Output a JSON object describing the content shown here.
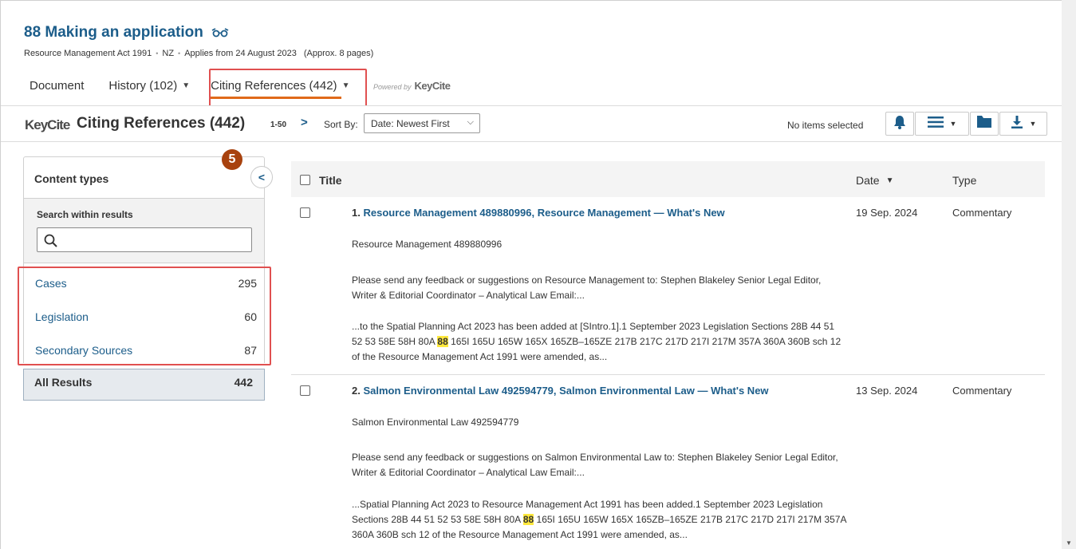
{
  "document": {
    "title": "88 Making an application",
    "meta": [
      "Resource Management Act 1991",
      "NZ",
      "Applies from 24 August 2023"
    ],
    "pages": "(Approx. 8 pages)"
  },
  "tabs": [
    {
      "label": "Document"
    },
    {
      "label": "History (102)"
    },
    {
      "label": "Citing References (442)"
    }
  ],
  "powered_by": {
    "text": "Powered by",
    "brand": "KeyCite"
  },
  "toolbar": {
    "logo": "KeyCite",
    "title": "Citing References (442)",
    "range": "1-50",
    "sort_label": "Sort By:",
    "sort_value": "Date: Newest First",
    "selection_status": "No items selected"
  },
  "sidebar": {
    "badge": "5",
    "heading": "Content types",
    "search_label": "Search within results",
    "search_placeholder": "",
    "facets": [
      {
        "name": "Cases",
        "count": "295"
      },
      {
        "name": "Legislation",
        "count": "60"
      },
      {
        "name": "Secondary Sources",
        "count": "87"
      }
    ],
    "all": {
      "name": "All Results",
      "count": "442"
    }
  },
  "table": {
    "columns": {
      "title": "Title",
      "date": "Date",
      "type": "Type"
    },
    "rows": [
      {
        "num": "1.",
        "title": "Resource Management 489880996, Resource Management — What's New",
        "date": "19 Sep. 2024",
        "type": "Commentary",
        "source": "Resource Management 489880996",
        "summary": "Please send any feedback or suggestions on Resource Management to: Stephen Blakeley Senior Legal Editor, Writer & Editorial Coordinator – Analytical Law Email:...",
        "snippet_before": "...to the Spatial Planning Act 2023 has been added at [SIntro.1].1 September 2023 Legislation Sections 28B 44 51 52 53 58E 58H 80A ",
        "snippet_hit": "88",
        "snippet_after": " 165I 165U 165W 165X 165ZB–165ZE 217B 217C 217D 217I 217M 357A 360A 360B sch 12 of the Resource Management Act 1991 were amended, as..."
      },
      {
        "num": "2.",
        "title": "Salmon Environmental Law 492594779, Salmon Environmental Law — What's New",
        "date": "13 Sep. 2024",
        "type": "Commentary",
        "source": "Salmon Environmental Law 492594779",
        "summary": "Please send any feedback or suggestions on Salmon Environmental Law to: Stephen Blakeley Senior Legal Editor, Writer & Editorial Coordinator – Analytical Law Email:...",
        "snippet_before": "...Spatial Planning Act 2023 to Resource Management Act 1991 has been added.1 September 2023 Legislation Sections 28B 44 51 52 53 58E 58H 80A ",
        "snippet_hit": "88",
        "snippet_after": " 165I 165U 165W 165X 165ZB–165ZE 217B 217C 217D 217I 217M 357A 360A 360B sch 12 of the Resource Management Act 1991 were amended, as..."
      }
    ]
  },
  "colors": {
    "link": "#1c5d8a",
    "accent": "#e06a1a",
    "callout": "#e05050",
    "badge": "#a8420e",
    "highlight": "#ffe83d"
  }
}
